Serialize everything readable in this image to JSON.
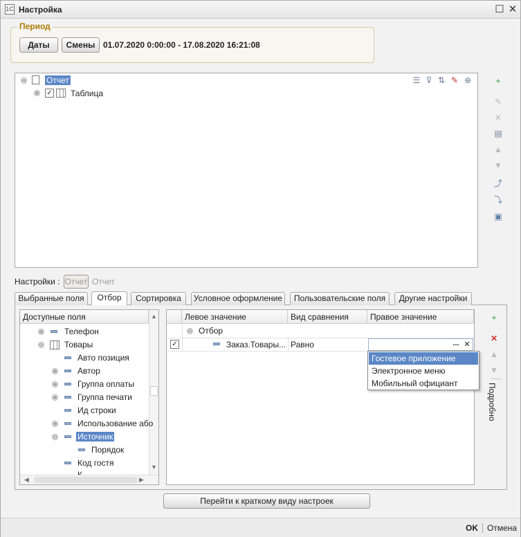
{
  "window": {
    "title": "Настройка",
    "app_icon": "1C",
    "restore_icon": "☐",
    "close_icon": "✕"
  },
  "period": {
    "title": "Период",
    "dates_label": "Даты",
    "shifts_label": "Смены",
    "range": "01.07.2020 0:00:00 - 17.08.2020 16:21:08"
  },
  "structure": {
    "items": [
      {
        "label": "Отчет",
        "selected": true,
        "expander": "⊖"
      },
      {
        "label": "Таблица",
        "checked": true,
        "expander": "⊕"
      }
    ]
  },
  "settings_bar": {
    "label": "Настройки :",
    "button": "Отчет",
    "value": "Отчет"
  },
  "tabs": [
    {
      "label": "Выбранные поля"
    },
    {
      "label": "Отбор",
      "active": true
    },
    {
      "label": "Сортировка"
    },
    {
      "label": "Условное оформление"
    },
    {
      "label": "Пользовательские поля"
    },
    {
      "label": "Другие настройки"
    }
  ],
  "fields": {
    "header": "Доступные поля",
    "items": [
      {
        "label": "Телефон",
        "expander": "⊕"
      },
      {
        "label": "Товары",
        "expander": "⊖"
      },
      {
        "label": "Авто позиция"
      },
      {
        "label": "Автор",
        "expander": "⊕"
      },
      {
        "label": "Группа оплаты",
        "expander": "⊕"
      },
      {
        "label": "Группа печати",
        "expander": "⊕"
      },
      {
        "label": "Ид строки"
      },
      {
        "label": "Использование або",
        "expander": "⊕"
      },
      {
        "label": "Источник",
        "expander": "⊖",
        "selected": true
      },
      {
        "label": "Порядок"
      },
      {
        "label": "Код гостя"
      },
      {
        "label": "К"
      }
    ]
  },
  "filter": {
    "columns": [
      "Левое значение",
      "Вид сравнения",
      "Правое значение"
    ],
    "group_label": "Отбор",
    "group_expander": "⊖",
    "row": {
      "left": "Заказ.Товары...",
      "compare": "Равно",
      "right": ""
    },
    "ellipsis": "...",
    "clear": "✕"
  },
  "dropdown": {
    "options": [
      "Гостевое приложение",
      "Электронное меню",
      "Мобильный официант"
    ],
    "selected_index": 0
  },
  "details_label": "Подробно",
  "short_view_button": "Перейти к краткому виду настроек",
  "footer": {
    "ok": "OK",
    "cancel": "Отмена"
  },
  "colors": {
    "selection": "#5b87c6",
    "period_title": "#b07c00"
  }
}
